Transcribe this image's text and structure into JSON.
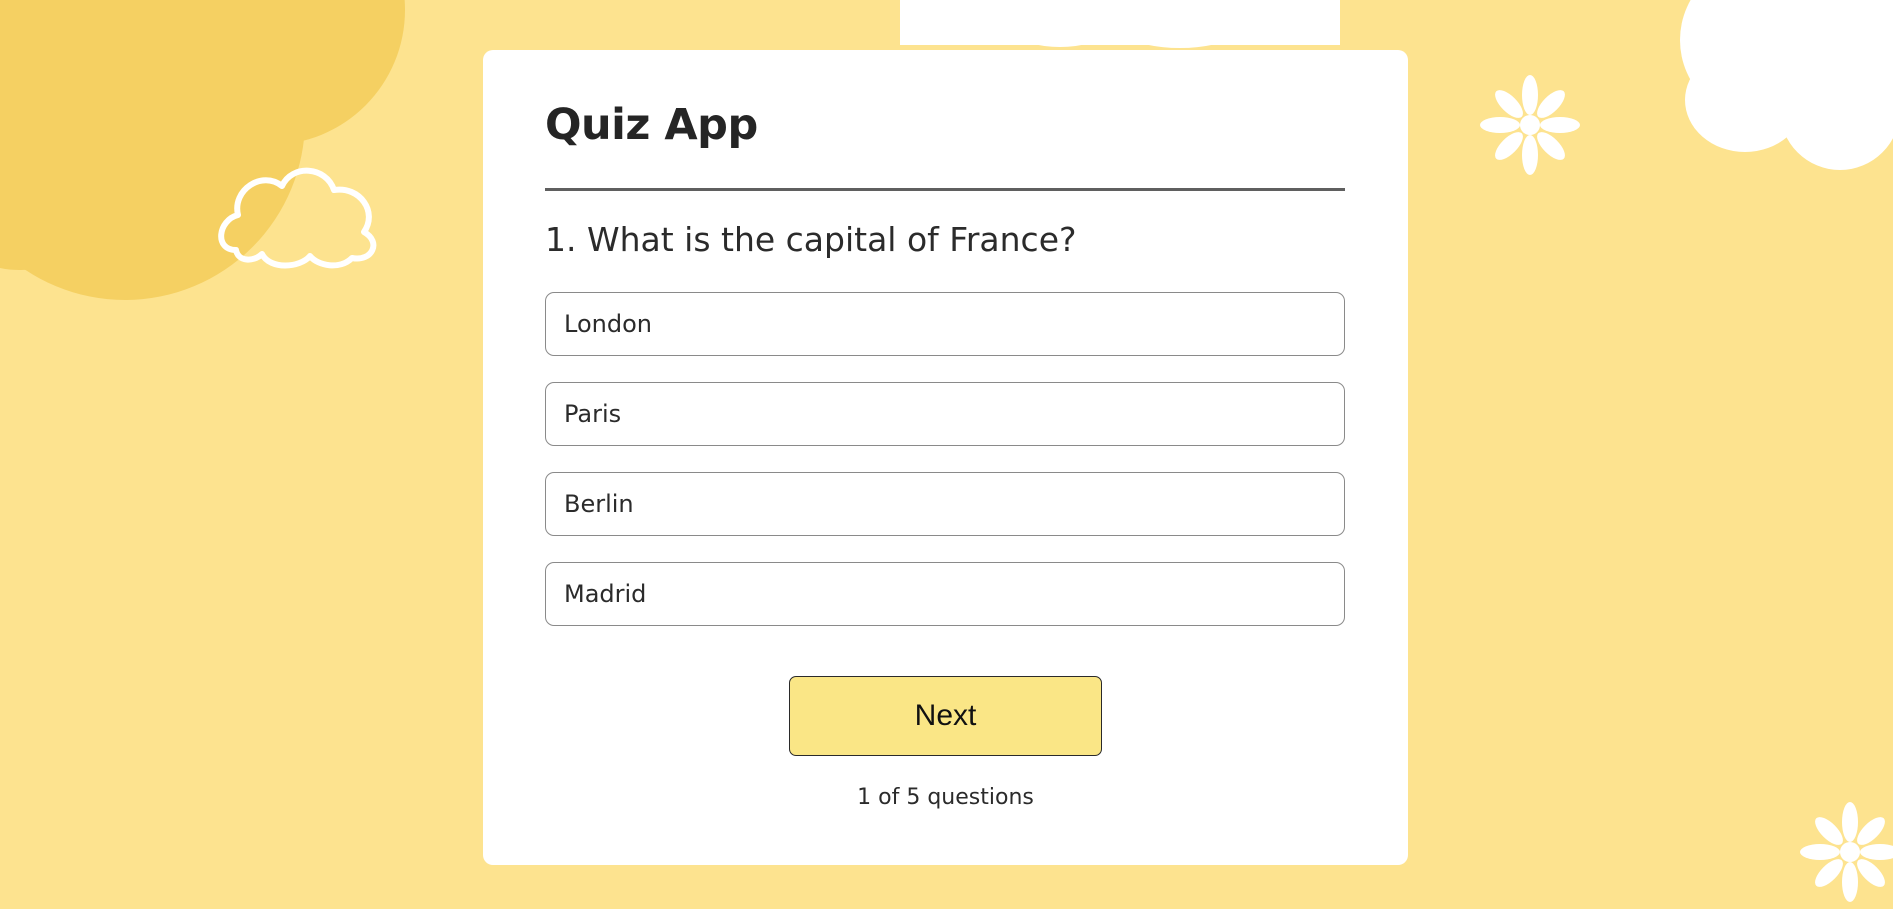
{
  "theme": {
    "background": "#fde38f",
    "sun": "#f5d062",
    "cloud": "#ffffff",
    "card": "#ffffff",
    "button": "#fae686"
  },
  "quiz": {
    "title": "Quiz App",
    "question": "1. What is the capital of France?",
    "answers": [
      "London",
      "Paris",
      "Berlin",
      "Madrid"
    ],
    "next_label": "Next",
    "progress": "1 of 5 questions"
  },
  "decorations": {
    "icons": [
      "sun-shape",
      "cloud-outline-icon",
      "cloud-shape",
      "flower-icon"
    ]
  }
}
